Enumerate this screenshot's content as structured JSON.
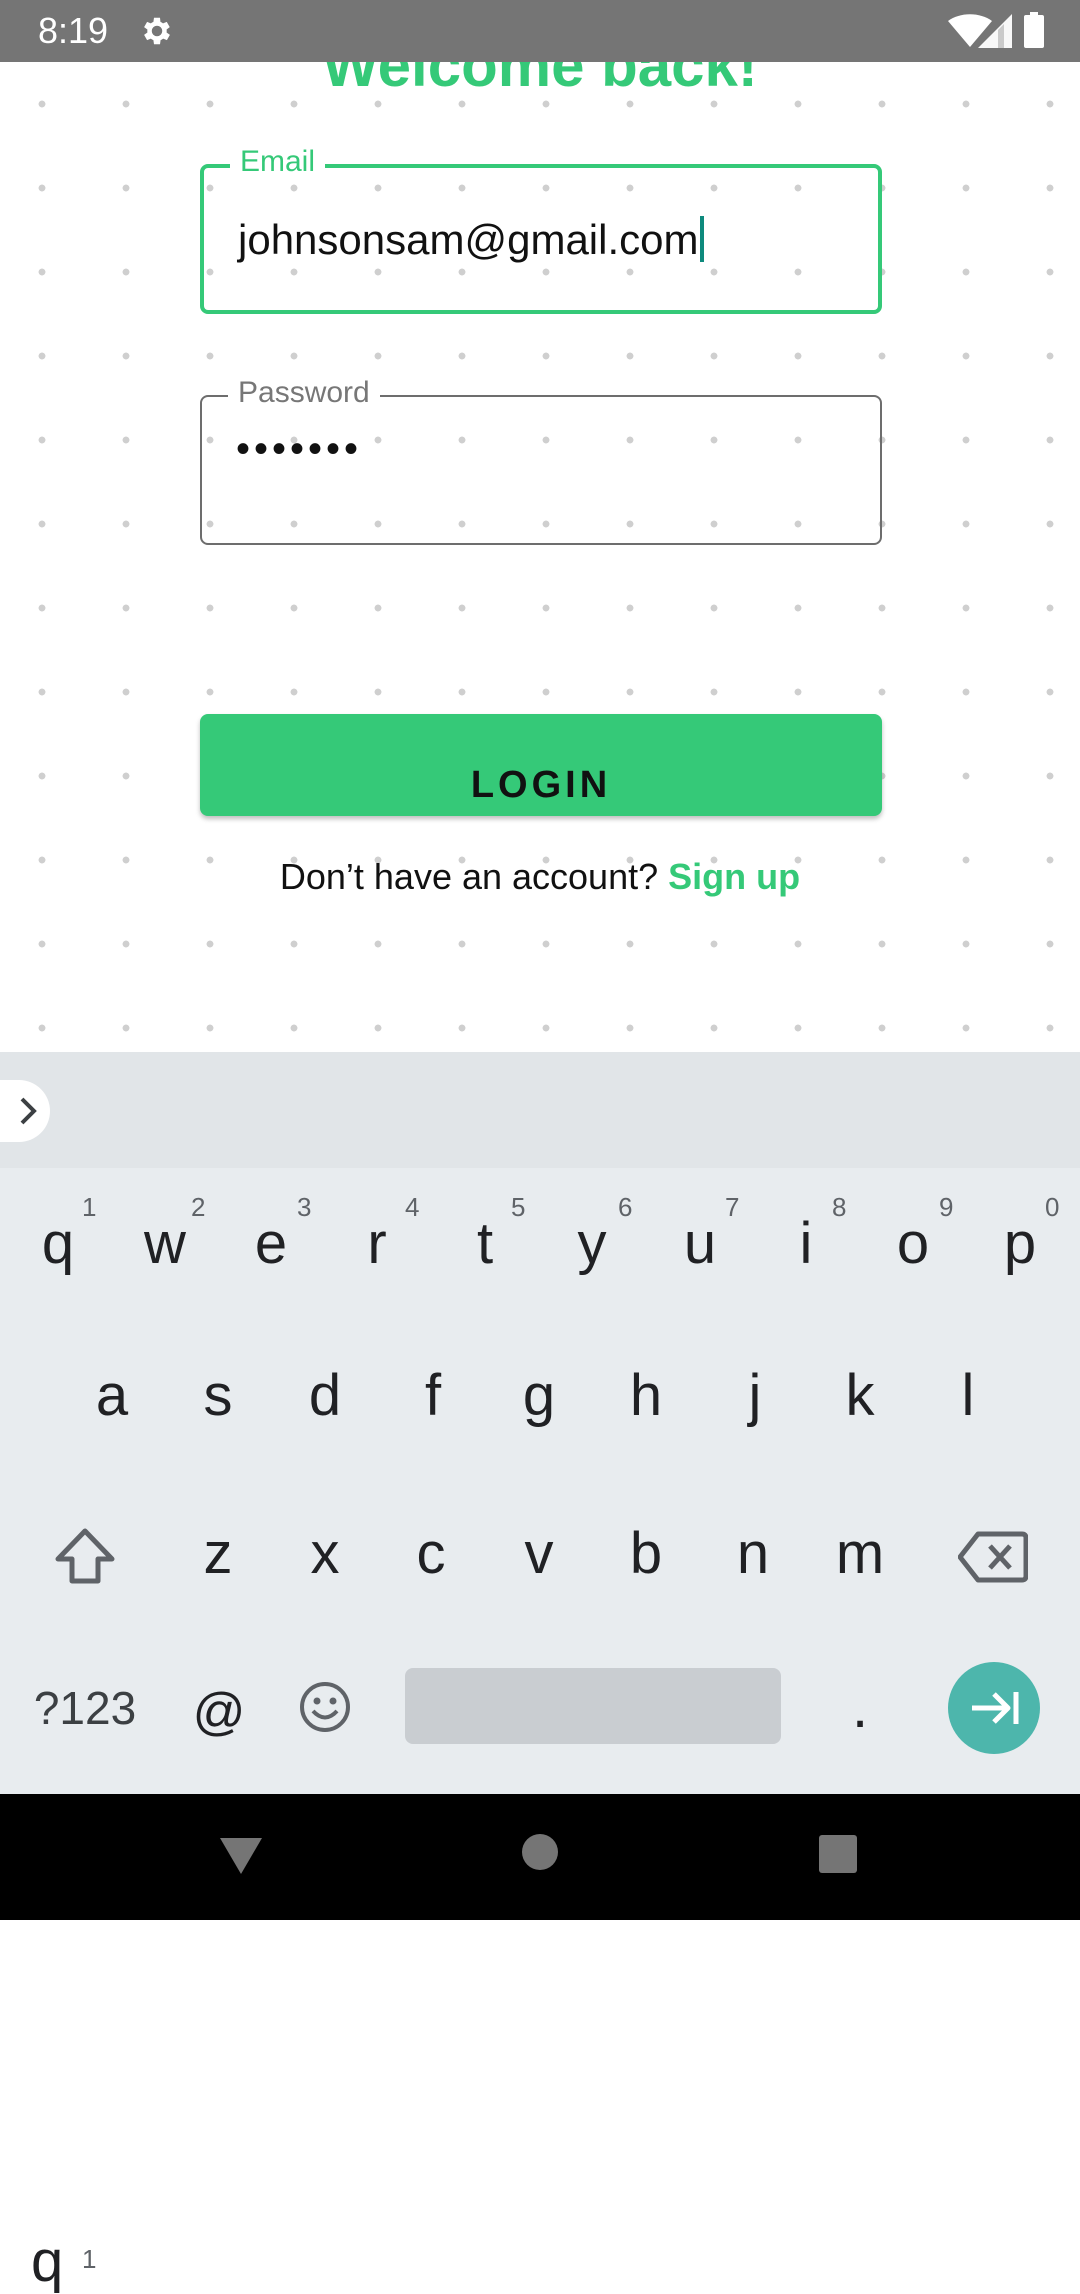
{
  "status_bar": {
    "time": "8:19"
  },
  "form": {
    "title": "Welcome back!",
    "email_label": "Email",
    "email_value": "johnsonsam@gmail.com",
    "password_label": "Password",
    "password_value": "•••••••",
    "login_label": "LOGIN",
    "signup_prompt": "Don’t have an account?",
    "signup_link": "Sign up"
  },
  "keyboard": {
    "row1": [
      "q",
      "w",
      "e",
      "r",
      "t",
      "y",
      "u",
      "i",
      "o",
      "p"
    ],
    "row1_hints": [
      "1",
      "2",
      "3",
      "4",
      "5",
      "6",
      "7",
      "8",
      "9",
      "0"
    ],
    "row2": [
      "a",
      "s",
      "d",
      "f",
      "g",
      "h",
      "j",
      "k",
      "l"
    ],
    "row3": [
      "z",
      "x",
      "c",
      "v",
      "b",
      "n",
      "m"
    ],
    "symbols_key": "?123",
    "at_key": "@",
    "period_key": "."
  },
  "colors": {
    "accent": "#35c978",
    "enter_key": "#4db6ac"
  }
}
